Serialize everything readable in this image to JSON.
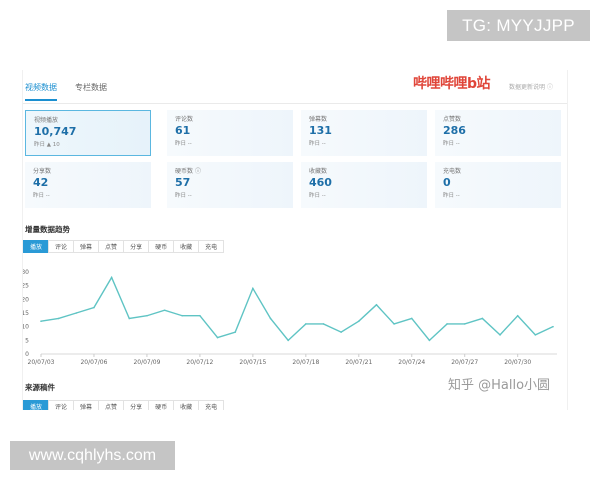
{
  "watermarks": {
    "top": "TG: MYYJJPP",
    "bottom": "www.cqhlyhs.com",
    "zhihu": "知乎 @Hallo小圆"
  },
  "header": {
    "tabs": [
      {
        "label": "视频数据",
        "active": true
      },
      {
        "label": "专栏数据",
        "active": false
      }
    ],
    "logo": "哔哩哔哩b站",
    "update_info": "数据更新说明"
  },
  "cards": [
    {
      "label": "视频播放",
      "value": "10,747",
      "sub": "昨日 ▲ 10",
      "active": true
    },
    {
      "label": "评论数",
      "value": "61",
      "sub": "昨日 --"
    },
    {
      "label": "弹幕数",
      "value": "131",
      "sub": "昨日 --"
    },
    {
      "label": "点赞数",
      "value": "286",
      "sub": "昨日 --"
    },
    {
      "label": "分享数",
      "value": "42",
      "sub": "昨日 --"
    },
    {
      "label": "硬币数",
      "value": "57",
      "sub": "昨日 --"
    },
    {
      "label": "收藏数",
      "value": "460",
      "sub": "昨日 --"
    },
    {
      "label": "充电数",
      "value": "0",
      "sub": "昨日 --"
    }
  ],
  "trend": {
    "title": "增量数据趋势",
    "filters": [
      "播放",
      "评论",
      "弹幕",
      "点赞",
      "分享",
      "硬币",
      "收藏",
      "充电"
    ],
    "active_filter": "播放"
  },
  "source": {
    "title": "来源稿件",
    "filters": [
      "播放",
      "评论",
      "弹幕",
      "点赞",
      "分享",
      "硬币",
      "收藏",
      "充电"
    ],
    "active_filter": "播放"
  },
  "colors": {
    "accent": "#1b8fd0",
    "line": "#5fc4c4",
    "logo": "#e0463a"
  },
  "chart_data": {
    "type": "line",
    "title": "",
    "xlabel": "",
    "ylabel": "",
    "x": [
      "20/07/03",
      "20/07/04",
      "20/07/05",
      "20/07/06",
      "20/07/07",
      "20/07/08",
      "20/07/09",
      "20/07/10",
      "20/07/11",
      "20/07/12",
      "20/07/13",
      "20/07/14",
      "20/07/15",
      "20/07/16",
      "20/07/17",
      "20/07/18",
      "20/07/19",
      "20/07/20",
      "20/07/21",
      "20/07/22",
      "20/07/23",
      "20/07/24",
      "20/07/25",
      "20/07/26",
      "20/07/27",
      "20/07/28",
      "20/07/29",
      "20/07/30",
      "20/07/31",
      "20/08/01"
    ],
    "x_ticks": [
      "20/07/03",
      "20/07/06",
      "20/07/09",
      "20/07/12",
      "20/07/15",
      "20/07/18",
      "20/07/21",
      "20/07/24",
      "20/07/27",
      "20/07/30"
    ],
    "series": [
      {
        "values": [
          12,
          13,
          15,
          17,
          28,
          13,
          14,
          16,
          14,
          14,
          6,
          8,
          24,
          13,
          5,
          11,
          11,
          8,
          12,
          18,
          11,
          13,
          5,
          11,
          11,
          13,
          7,
          14,
          7,
          10
        ]
      }
    ],
    "ylim": [
      0,
      30
    ],
    "y_ticks": [
      0,
      5,
      10,
      15,
      20,
      25,
      30
    ],
    "grid": false
  }
}
